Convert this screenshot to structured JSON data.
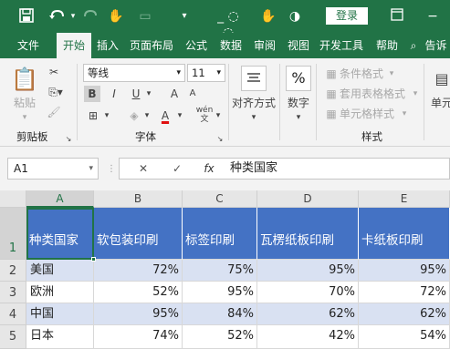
{
  "titlebar": {
    "login_label": "登录",
    "icons": [
      "save-icon",
      "undo-icon",
      "redo-icon",
      "customize-icon",
      "restore-icon"
    ]
  },
  "menu": {
    "tabs": [
      {
        "label": "文件"
      },
      {
        "label": "开始"
      },
      {
        "label": "插入"
      },
      {
        "label": "页面布局"
      },
      {
        "label": "公式"
      },
      {
        "label": "数据"
      },
      {
        "label": "审阅"
      },
      {
        "label": "视图"
      },
      {
        "label": "开发工具"
      },
      {
        "label": "帮助"
      },
      {
        "label": "告诉"
      }
    ]
  },
  "ribbon": {
    "clipboard": {
      "paste_label": "粘贴",
      "group_label": "剪贴板"
    },
    "font": {
      "name": "等线",
      "size": "11",
      "bold": "B",
      "italic": "I",
      "underline": "U",
      "grow": "A",
      "shrink": "A",
      "color_a": "A",
      "phonetic": "wén",
      "group_label": "字体"
    },
    "alignment": {
      "label": "对齐方式"
    },
    "number": {
      "label": "数字",
      "percent_symbol": "%"
    },
    "styles": {
      "conditional": "条件格式",
      "table_format": "套用表格格式",
      "cell_styles": "单元格样式",
      "group_label": "样式"
    },
    "cells": {
      "label": "单元"
    }
  },
  "formula_bar": {
    "name_box": "A1",
    "fx": "fx",
    "content": "种类国家"
  },
  "sheet": {
    "columns": [
      "A",
      "B",
      "C",
      "D",
      "E"
    ],
    "row_numbers": [
      "1",
      "2",
      "3",
      "4",
      "5"
    ],
    "header": [
      "种类国家",
      "软包装印刷",
      "标签印刷",
      "瓦楞纸板印刷",
      "卡纸板印刷"
    ],
    "rows": [
      [
        "美国",
        "72%",
        "75%",
        "95%",
        "95%"
      ],
      [
        "欧洲",
        "52%",
        "95%",
        "70%",
        "72%"
      ],
      [
        "中国",
        "95%",
        "84%",
        "62%",
        "62%"
      ],
      [
        "日本",
        "74%",
        "52%",
        "42%",
        "54%"
      ]
    ],
    "header_color": "#4472c4",
    "band_color": "#d9e1f2",
    "accent_color": "#217346"
  }
}
